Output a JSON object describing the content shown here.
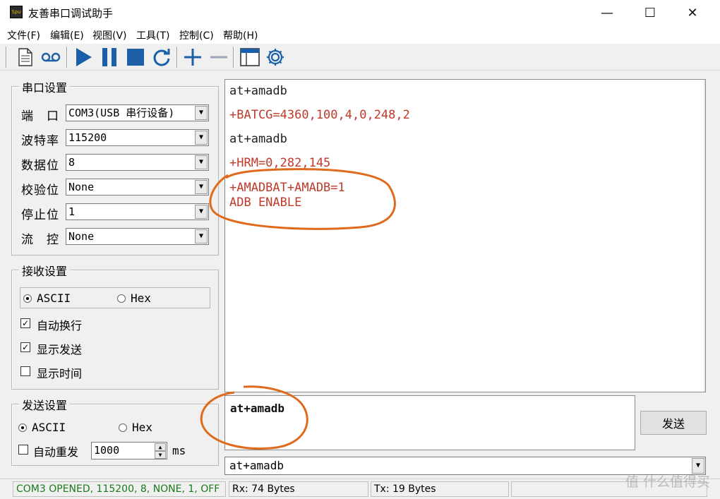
{
  "window": {
    "title": "友善串口调试助手",
    "icon_text": "Spu",
    "controls": [
      "—",
      "☐",
      "✕"
    ]
  },
  "menu": [
    "文件(F)",
    "编辑(E)",
    "视图(V)",
    "工具(T)",
    "控制(C)",
    "帮助(H)"
  ],
  "toolbar": {
    "icons": [
      "document-icon",
      "cassette-icon",
      "play-icon",
      "pause-icon",
      "stop-icon",
      "refresh-icon",
      "plus-icon",
      "minus-icon",
      "window-icon",
      "gear-icon"
    ]
  },
  "serial_settings": {
    "title": "串口设置",
    "fields": [
      {
        "label": "端　口",
        "value": "COM3(USB 串行设备)"
      },
      {
        "label": "波特率",
        "value": "115200"
      },
      {
        "label": "数据位",
        "value": "8"
      },
      {
        "label": "校验位",
        "value": "None"
      },
      {
        "label": "停止位",
        "value": "1"
      },
      {
        "label": "流　控",
        "value": "None"
      }
    ]
  },
  "receive_settings": {
    "title": "接收设置",
    "mode_ascii": "ASCII",
    "mode_hex": "Hex",
    "selected_mode": "ASCII",
    "options": [
      {
        "label": "自动换行",
        "checked": true
      },
      {
        "label": "显示发送",
        "checked": true
      },
      {
        "label": "显示时间",
        "checked": false
      }
    ]
  },
  "send_settings": {
    "title": "发送设置",
    "mode_ascii": "ASCII",
    "mode_hex": "Hex",
    "selected_mode": "ASCII",
    "auto_resend_label": "自动重发",
    "auto_resend_checked": false,
    "interval": "1000",
    "interval_unit": "ms"
  },
  "receive_lines": [
    {
      "text": "at+amadb",
      "color": "#222222"
    },
    {
      "text": "+BATCG=4360,100,4,0,248,2",
      "color": "#c0392b"
    },
    {
      "text": "at+amadb",
      "color": "#222222"
    },
    {
      "text": "+HRM=0,282,145",
      "color": "#c0392b"
    },
    {
      "text": "+AMADBAT+AMADB=1",
      "color": "#c0392b"
    },
    {
      "text": "ADB ENABLE",
      "color": "#c0392b"
    }
  ],
  "send_input": "at+amadb",
  "send_button": "发送",
  "history_value": "at+amadb",
  "status": {
    "port": "COM3 OPENED, 115200, 8, NONE, 1, OFF",
    "rx": "Rx: 74 Bytes",
    "tx": "Tx: 19 Bytes"
  },
  "watermark": "值 什么值得买",
  "colors": {
    "received_text": "#c0392b",
    "sent_text": "#222222",
    "status_green": "#1a7a1a",
    "annotation": "#e06a1c",
    "toolbar_blue": "#1a5fa8"
  }
}
